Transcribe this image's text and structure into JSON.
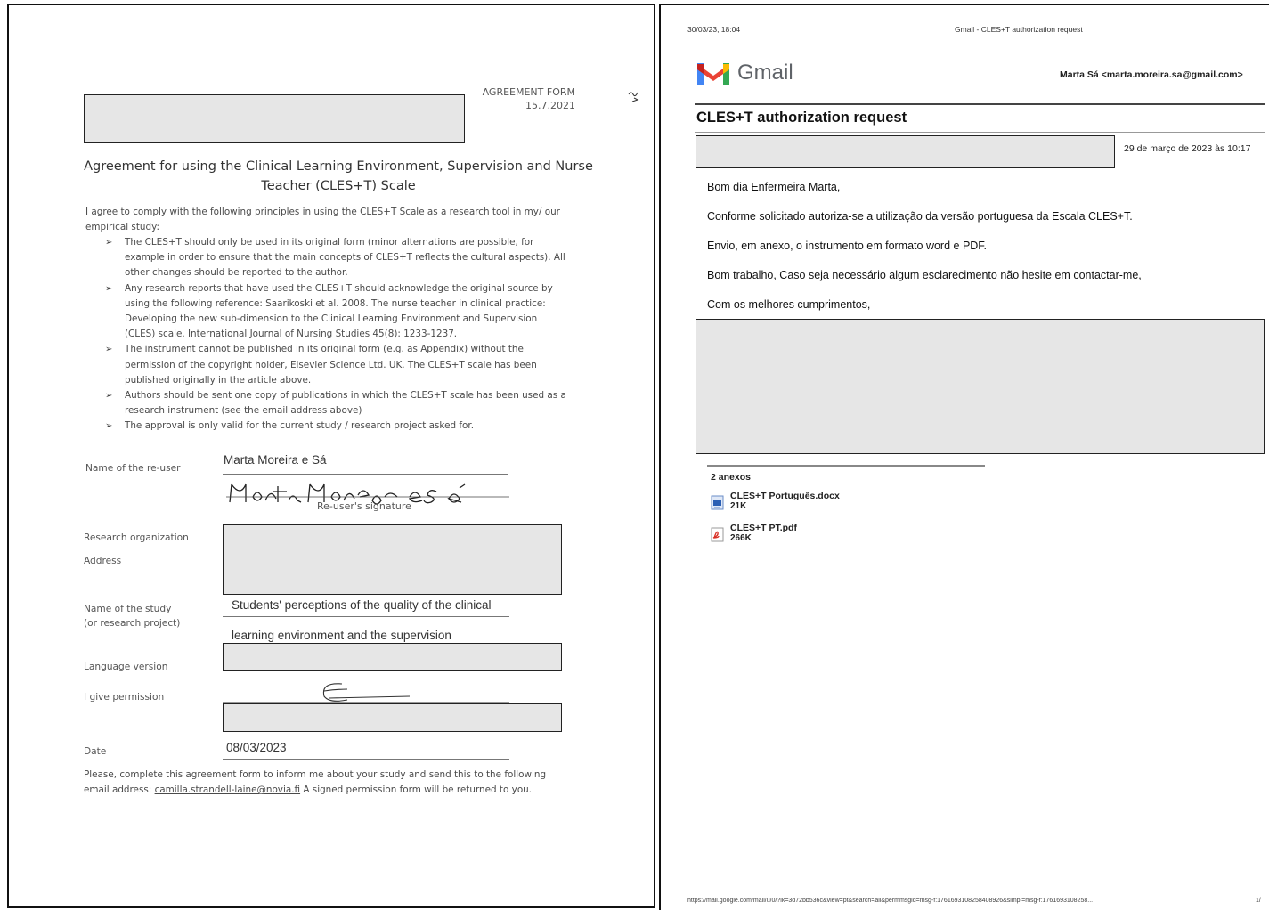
{
  "left_doc": {
    "header": {
      "form_label": "AGREEMENT FORM",
      "form_date": "15.7.2021"
    },
    "title_line1": "Agreement for using the Clinical Learning Environment, Supervision and Nurse",
    "title_line2": "Teacher (CLES+T) Scale",
    "intro_line1": "I agree to comply with the following principles in using the CLES+T Scale as a research tool in my/ our",
    "intro_line2": "empirical study:",
    "principles": [
      [
        "The CLES+T should only be used in its original form (minor alternations are possible, for",
        "example in order to ensure that the main concepts of CLES+T reflects the cultural aspects). All",
        "other changes should be reported to the author."
      ],
      [
        "Any research reports that have used the CLES+T should acknowledge the original source by",
        "using the following reference: Saarikoski et al. 2008. The nurse teacher in clinical practice:",
        "Developing the new sub-dimension to the Clinical Learning Environment and Supervision",
        "(CLES) scale. International Journal of Nursing Studies 45(8): 1233-1237."
      ],
      [
        "The instrument cannot be published in its original form (e.g. as Appendix) without the",
        "permission of the copyright holder, Elsevier Science Ltd. UK. The CLES+T scale has been",
        "published originally in the article above."
      ],
      [
        "Authors should be sent one copy of publications in which the CLES+T scale has been used as a",
        "research instrument (see the email address above)"
      ],
      [
        "The approval is only valid for the current study / research project asked for."
      ]
    ],
    "bullet_glyph": "➢",
    "fields": {
      "reuser_label": "Name of the re-user",
      "reuser_value": "Marta Moreira e Sá",
      "signature_caption": "Re-user's signature",
      "research_org_label": "Research organization",
      "address_label": "Address",
      "study_label_line1": "Name of the study",
      "study_label_line2": "(or research project)",
      "study_value_line1": "Students' perceptions of the quality of the clinical",
      "study_value_line2": "learning environment and the supervision",
      "language_label": "Language version",
      "permission_label": "I give permission",
      "date_label": "Date",
      "date_value": "08/03/2023"
    },
    "footer_line1": "Please, complete this agreement form to inform me about your study and send this to the following",
    "footer_line2_prefix": "email address: ",
    "footer_email": "camilla.strandell-laine@novia.fi",
    "footer_line2_suffix": "  A signed permission form will be returned to you."
  },
  "gmail": {
    "print_datetime": "30/03/23, 18:04",
    "print_title": "Gmail - CLES+T authorization request",
    "logo_text": "Gmail",
    "account": "Marta Sá <marta.moreira.sa@gmail.com>",
    "subject": "CLES+T authorization request",
    "date": "29 de março de 2023 às 10:17",
    "body": [
      "Bom dia Enfermeira Marta,",
      "Conforme solicitado autoriza-se a utilização da versão portuguesa da Escala CLES+T.",
      "Envio, em anexo, o instrumento em formato word e PDF.",
      "Bom trabalho, Caso seja necessário algum esclarecimento não hesite em contactar-me,",
      "Com os melhores cumprimentos,"
    ],
    "attachments_title": "2 anexos",
    "attachments": [
      {
        "name": "CLES+T Português.docx",
        "size": "21K",
        "icon": "word-doc-icon"
      },
      {
        "name": "CLES+T PT.pdf",
        "size": "266K",
        "icon": "pdf-icon"
      }
    ],
    "footer_url": "https://mail.google.com/mail/u/0/?ik=3d72bb536c&view=pt&search=all&permmsgid=msg-f:1761693108258408926&simpl=msg-f:1761693108258...",
    "footer_page": "1/"
  },
  "colors": {
    "redaction_fill": "#e6e6e6",
    "gmail_red": "#ea4335",
    "gmail_blue": "#4285f4",
    "gmail_green": "#34a853",
    "gmail_yellow": "#fbbc04",
    "link_color": "#4a4a4a"
  }
}
